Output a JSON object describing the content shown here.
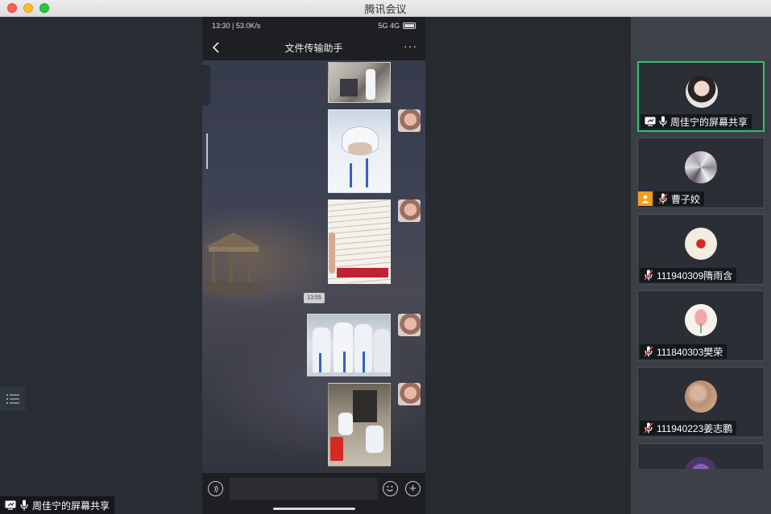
{
  "window": {
    "title": "腾讯会议"
  },
  "share": {
    "presenter_label": "周佳宁的屏幕共享"
  },
  "phone": {
    "status_time": "13:30 | 53.0K/s",
    "status_right": "5G 4G",
    "battery": "100",
    "chat_title": "文件传输助手",
    "more": "···",
    "time_tag": "13:55",
    "plus": "+"
  },
  "participants": [
    {
      "name": "周佳宁的屏幕共享",
      "active": true,
      "mic": "on",
      "sharing": true
    },
    {
      "name": "曹子姣",
      "active": false,
      "mic": "muted",
      "sharing": false
    },
    {
      "name": "111940309隋雨含",
      "active": false,
      "mic": "muted",
      "sharing": false
    },
    {
      "name": "111840303樊荣",
      "active": false,
      "mic": "muted",
      "sharing": false
    },
    {
      "name": "111940223姜志鹏",
      "active": false,
      "mic": "muted",
      "sharing": false
    }
  ],
  "colors": {
    "active_border": "#2ec26b",
    "badge_orange": "#f39b1b",
    "muted_red": "#e0443a"
  },
  "icons": {
    "screen_share": "screen-share-icon",
    "mic": "microphone-icon",
    "mic_muted": "microphone-muted-icon",
    "list": "list-icon",
    "back": "chevron-left-icon",
    "voice": "voice-icon",
    "emoji": "emoji-icon",
    "plus": "plus-icon",
    "person_badge": "person-badge-icon"
  }
}
